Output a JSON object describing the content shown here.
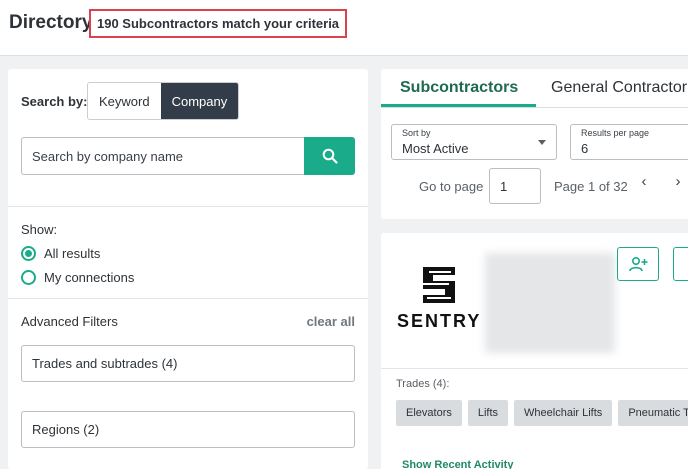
{
  "header": {
    "title": "Directory",
    "match_text": "190 Subcontractors match your criteria"
  },
  "filters": {
    "search_by_label": "Search by:",
    "search_modes": [
      "Keyword",
      "Company"
    ],
    "active_mode": "Company",
    "search_placeholder": "Search by company name",
    "show_label": "Show:",
    "show_options": [
      "All results",
      "My connections"
    ],
    "show_selected": "All results",
    "advanced_label": "Advanced Filters",
    "clear_all": "clear all",
    "trades_filter": "Trades and subtrades (4)",
    "regions_filter": "Regions (2)"
  },
  "results": {
    "tabs": [
      "Subcontractors",
      "General Contractor"
    ],
    "active_tab": "Subcontractors",
    "sort_label": "Sort by",
    "sort_value": "Most Active",
    "per_page_label": "Results per page",
    "per_page_value": "6",
    "goto_label": "Go to page",
    "page_value": "1",
    "page_of": "Page 1 of 32"
  },
  "card": {
    "logo_text": "SENTRY",
    "trades_label": "Trades (4):",
    "trades": [
      "Elevators",
      "Lifts",
      "Wheelchair Lifts",
      "Pneumatic Tub"
    ],
    "recent_activity": "Show Recent Activity"
  },
  "colors": {
    "accent": "#1aab8a",
    "dark_tab": "#333d49",
    "highlight_border": "#d9424f"
  }
}
